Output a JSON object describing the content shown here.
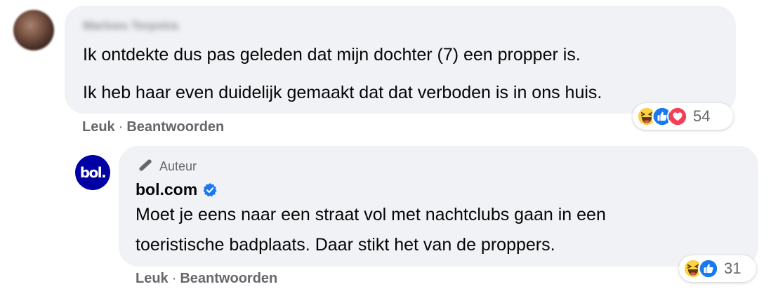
{
  "comments": [
    {
      "author": "Marloes Terpstra",
      "text_lines": [
        "Ik ontdekte dus pas geleden dat mijn dochter (7) een propper is.",
        "Ik heb haar even duidelijk gemaakt dat dat verboden is in ons huis."
      ],
      "actions": {
        "like": "Leuk",
        "separator": "·",
        "reply": "Beantwoorden"
      },
      "reactions": {
        "icons": [
          "haha-icon",
          "like-icon",
          "love-icon"
        ],
        "count": "54"
      }
    }
  ],
  "reply": {
    "avatar_text": "bol.",
    "author_tag": "Auteur",
    "author": "bol.com",
    "verified": true,
    "text_lines": [
      "Moet je eens naar een straat vol met nachtclubs gaan in een",
      "toeristische badplaats. Daar stikt het van de proppers."
    ],
    "actions": {
      "like": "Leuk",
      "separator": "·",
      "reply": "Beantwoorden"
    },
    "reactions": {
      "icons": [
        "haha-icon",
        "like-icon"
      ],
      "count": "31"
    }
  },
  "colors": {
    "bubble": "#f0f2f5",
    "meta_text": "#65676b",
    "like_blue": "#1877f2",
    "love_red": "#f33e58",
    "haha_yellow": "#fcd147",
    "bol_brand": "#0000a4"
  }
}
